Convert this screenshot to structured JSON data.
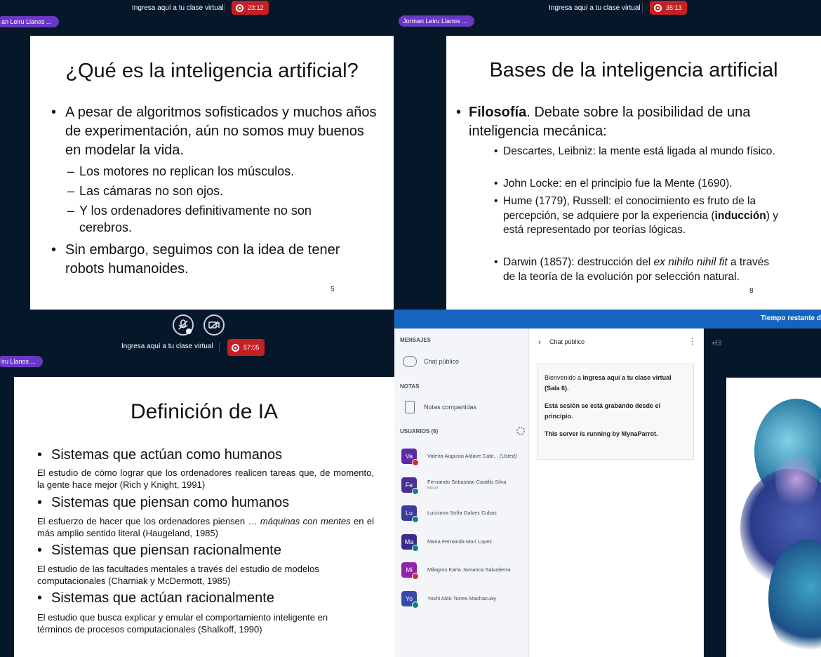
{
  "colors": {
    "background": "#06172a",
    "recording": "#c52024",
    "presenter_pill": "#6a38c7",
    "accent": "#1565c0"
  },
  "panel1": {
    "session_title": "Ingresa aquí a tu clase virtual",
    "recording_time": "23:12",
    "presenter": "an Leiru Llanos ...",
    "slide": {
      "title": "¿Qué es la inteligencia artificial?",
      "bullet1": "A pesar de algoritmos sofisticados y muchos años de experimentación, aún no somos muy buenos en modelar la vida.",
      "dash1": "Los motores no replican los músculos.",
      "dash2": "Las cámaras no son ojos.",
      "dash3": "Y los ordenadores definitivamente no son cerebros.",
      "bullet2": "Sin embargo, seguimos con la idea de tener robots humanoides.",
      "page": "5"
    }
  },
  "panel2": {
    "session_title": "Ingresa aquí a tu clase virtual",
    "recording_time": "35:13",
    "presenter": "Jorman Leiru Llanos ...",
    "slide": {
      "title": "Bases de la inteligencia artificial",
      "main_bold": "Filosofía",
      "main_rest": ". Debate sobre la posibilidad de una inteligencia mecánica:",
      "s1": "Descartes, Leibniz: la mente está ligada al mundo físico.",
      "s2": "John Locke: en el principio fue la Mente (1690).",
      "s3a": "Hume (1779), Russell: el conocimiento es fruto de la percepción, se adquiere por la experiencia (",
      "s3b": "inducción",
      "s3c": ") y está representado por teorías lógicas.",
      "s4a": "Darwin (1857): destrucción del ",
      "s4b": "ex nihilo nihil fit",
      "s4c": " a través de la teoría de la evolución por selección natural.",
      "page": "8"
    }
  },
  "panel3": {
    "session_title": "Ingresa aquí a tu clase virtual",
    "recording_time": "57:05",
    "presenter": "iru Llanos ...",
    "slide": {
      "title": "Definición de IA",
      "h1": "Sistemas que actúan como humanos",
      "d1": "El estudio de cómo lograr que los ordenadores realicen tareas que, de momento, la gente hace mejor (Rich y Knight, 1991)",
      "h2": "Sistemas que piensan como humanos",
      "d2a": "El esfuerzo de hacer que los ordenadores piensen … ",
      "d2b": "máquinas con mentes",
      "d2c": " en el más amplio sentido literal (Haugeland, 1985)",
      "h3": "Sistemas que piensan racionalmente",
      "d3": "El estudio de las facultades mentales a través del estudio de modelos computacionales (Charniak y McDermott, 1985)",
      "h4": "Sistemas que actúan racionalmente",
      "d4": "El estudio que busca explicar y emular el comportamiento inteligente en términos de procesos computacionales (Shalkoff, 1990)"
    }
  },
  "panel4": {
    "top_banner": "Tiempo restante d",
    "messages_header": "MENSAJES",
    "public_chat": "Chat público",
    "notes_header": "NOTAS",
    "shared_notes": "Notas compartidas",
    "users_header": "USUARIOS (6)",
    "users": [
      {
        "initials": "Va",
        "name": "Valeria Augusta Aldave Cabr...",
        "tag": "(Usted)",
        "sub": "",
        "avatar_color": "#5b2aa8",
        "badge_color": "#d32f2f"
      },
      {
        "initials": "Fe",
        "name": "Fernando Sebastian Castillo Silva",
        "tag": "",
        "sub": "Móvil",
        "avatar_color": "#4a2d96",
        "badge_color": "#00897b"
      },
      {
        "initials": "Lu",
        "name": "Lucciana Sofía Galvez Cubas",
        "tag": "",
        "sub": "",
        "avatar_color": "#3b3a9e",
        "badge_color": "#00897b"
      },
      {
        "initials": "Ma",
        "name": "Maria Fernanda Mori Lopez",
        "tag": "",
        "sub": "",
        "avatar_color": "#3a2c8f",
        "badge_color": "#00897b"
      },
      {
        "initials": "Mi",
        "name": "Milagros Karla Jamanca Salvatierra",
        "tag": "",
        "sub": "",
        "avatar_color": "#8e24aa",
        "badge_color": "#d32f2f"
      },
      {
        "initials": "Yo",
        "name": "Yoshi Aldo Torres Machacuay",
        "tag": "",
        "sub": "",
        "avatar_color": "#3949ab",
        "badge_color": "#00897b"
      }
    ],
    "chat_title": "Chat público",
    "welcome_prefix": "Bienvenido a ",
    "welcome_room": "Ingresa aquí a tu clase virtual (Sala 6).",
    "welcome_rec": "Esta sesión se está grabando desde el principio.",
    "welcome_server": "This server is running by MynaParrot."
  }
}
